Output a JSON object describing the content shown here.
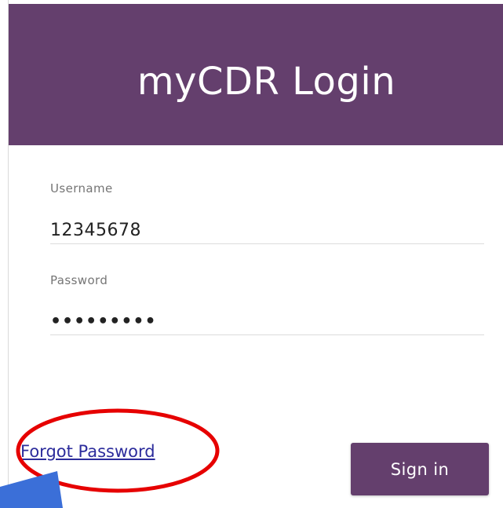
{
  "header": {
    "title": "myCDR Login"
  },
  "form": {
    "username_label": "Username",
    "username_value": "12345678",
    "password_label": "Password",
    "password_value": "•••••••••"
  },
  "actions": {
    "forgot_password_label": "Forgot Password",
    "sign_in_label": "Sign in"
  },
  "colors": {
    "brand": "#643f6d",
    "link": "#2c2c9c",
    "highlight": "#e60000",
    "pointer": "#3b6fd8"
  }
}
